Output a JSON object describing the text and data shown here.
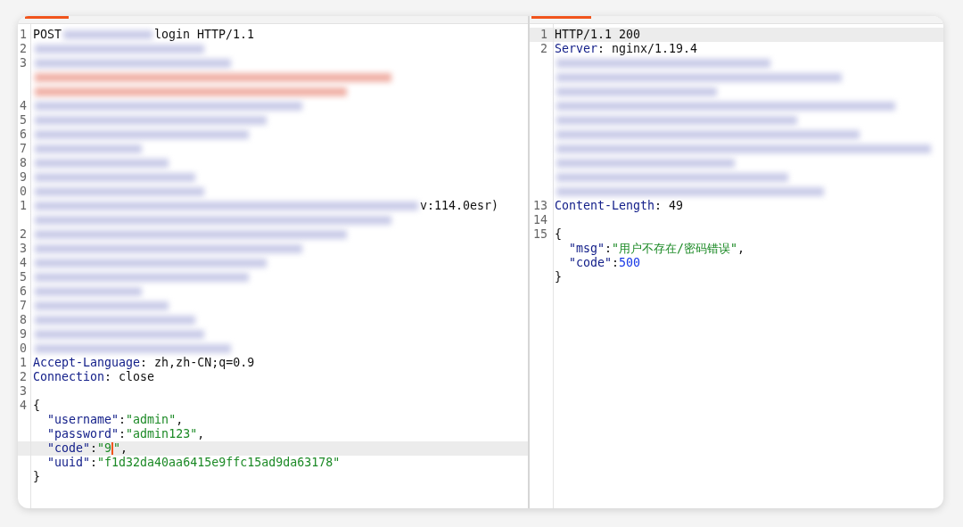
{
  "request": {
    "rows": [
      {
        "number": "1",
        "current": false,
        "segments": [
          {
            "kind": "plain",
            "text": "POST"
          },
          {
            "kind": "redacted"
          },
          {
            "kind": "plain",
            "text": "login HTTP/1.1"
          }
        ]
      },
      {
        "number": "2",
        "current": false,
        "segments": [
          {
            "kind": "redacted"
          }
        ]
      },
      {
        "number": "3",
        "current": false,
        "segments": [
          {
            "kind": "redacted"
          }
        ]
      },
      {
        "current": false,
        "segments": [
          {
            "kind": "redacted-alert"
          }
        ]
      },
      {
        "current": false,
        "segments": [
          {
            "kind": "redacted-alert"
          }
        ]
      },
      {
        "number": "4",
        "current": false,
        "segments": [
          {
            "kind": "redacted"
          }
        ]
      },
      {
        "number": "5",
        "current": false,
        "segments": [
          {
            "kind": "redacted"
          }
        ]
      },
      {
        "number": "6",
        "current": false,
        "segments": [
          {
            "kind": "redacted"
          }
        ]
      },
      {
        "number": "7",
        "current": false,
        "segments": [
          {
            "kind": "redacted"
          }
        ]
      },
      {
        "number": "8",
        "current": false,
        "segments": [
          {
            "kind": "redacted"
          }
        ]
      },
      {
        "number": "9",
        "current": false,
        "segments": [
          {
            "kind": "redacted"
          }
        ]
      },
      {
        "number": "0",
        "current": false,
        "segments": [
          {
            "kind": "redacted"
          }
        ]
      },
      {
        "number": "1",
        "current": false,
        "segments": [
          {
            "kind": "redacted"
          },
          {
            "kind": "plain",
            "text": "v:114.0esr)"
          }
        ]
      },
      {
        "current": false,
        "segments": [
          {
            "kind": "redacted"
          }
        ]
      },
      {
        "number": "2",
        "current": false,
        "segments": [
          {
            "kind": "redacted"
          }
        ]
      },
      {
        "number": "3",
        "current": false,
        "segments": [
          {
            "kind": "redacted"
          }
        ]
      },
      {
        "number": "4",
        "current": false,
        "segments": [
          {
            "kind": "redacted"
          }
        ]
      },
      {
        "number": "5",
        "current": false,
        "segments": [
          {
            "kind": "redacted"
          }
        ]
      },
      {
        "number": "6",
        "current": false,
        "segments": [
          {
            "kind": "redacted"
          }
        ]
      },
      {
        "number": "7",
        "current": false,
        "segments": [
          {
            "kind": "redacted"
          }
        ]
      },
      {
        "number": "8",
        "current": false,
        "segments": [
          {
            "kind": "redacted"
          }
        ]
      },
      {
        "number": "9",
        "current": false,
        "segments": [
          {
            "kind": "redacted"
          }
        ]
      },
      {
        "number": "0",
        "current": false,
        "segments": [
          {
            "kind": "redacted"
          }
        ]
      },
      {
        "number": "1",
        "current": false,
        "segments": [
          {
            "kind": "name",
            "text": "Accept-Language"
          },
          {
            "kind": "plain",
            "text": ": zh,zh-CN;q=0.9"
          }
        ]
      },
      {
        "number": "2",
        "current": false,
        "segments": [
          {
            "kind": "name",
            "text": "Connection"
          },
          {
            "kind": "plain",
            "text": ": close"
          }
        ]
      },
      {
        "number": "3",
        "current": false,
        "segments": []
      },
      {
        "number": "4",
        "current": false,
        "segments": [
          {
            "kind": "plain",
            "text": "{"
          }
        ]
      },
      {
        "current": false,
        "segments": [
          {
            "kind": "name",
            "text": "  \"username\""
          },
          {
            "kind": "plain",
            "text": ":"
          },
          {
            "kind": "string",
            "text": "\"admin\""
          },
          {
            "kind": "plain",
            "text": ","
          }
        ]
      },
      {
        "current": false,
        "segments": [
          {
            "kind": "name",
            "text": "  \"password\""
          },
          {
            "kind": "plain",
            "text": ":"
          },
          {
            "kind": "string",
            "text": "\"admin123\""
          },
          {
            "kind": "plain",
            "text": ","
          }
        ]
      },
      {
        "current": true,
        "segments": [
          {
            "kind": "name",
            "text": "  \"code\""
          },
          {
            "kind": "plain",
            "text": ":"
          },
          {
            "kind": "string",
            "text": "\"9"
          },
          {
            "kind": "caret"
          },
          {
            "kind": "string",
            "text": "\""
          },
          {
            "kind": "plain",
            "text": ","
          }
        ]
      },
      {
        "current": false,
        "segments": [
          {
            "kind": "name",
            "text": "  \"uuid\""
          },
          {
            "kind": "plain",
            "text": ":"
          },
          {
            "kind": "string",
            "text": "\"f1d32da40aa6415e9ffc15ad9da63178\""
          }
        ]
      },
      {
        "current": false,
        "segments": [
          {
            "kind": "plain",
            "text": "}"
          }
        ]
      }
    ]
  },
  "response": {
    "rows": [
      {
        "number": "1",
        "current": true,
        "segments": [
          {
            "kind": "plain",
            "text": "HTTP/1.1 200"
          }
        ]
      },
      {
        "number": "2",
        "current": false,
        "segments": [
          {
            "kind": "name",
            "text": "Server"
          },
          {
            "kind": "plain",
            "text": ": nginx/1.19.4"
          }
        ]
      },
      {
        "current": false,
        "segments": [
          {
            "kind": "redacted"
          }
        ]
      },
      {
        "current": false,
        "segments": [
          {
            "kind": "redacted"
          }
        ]
      },
      {
        "current": false,
        "segments": [
          {
            "kind": "redacted"
          }
        ]
      },
      {
        "current": false,
        "segments": [
          {
            "kind": "redacted"
          }
        ]
      },
      {
        "current": false,
        "segments": [
          {
            "kind": "redacted"
          }
        ]
      },
      {
        "current": false,
        "segments": [
          {
            "kind": "redacted"
          }
        ]
      },
      {
        "current": false,
        "segments": [
          {
            "kind": "redacted"
          }
        ]
      },
      {
        "current": false,
        "segments": [
          {
            "kind": "redacted"
          }
        ]
      },
      {
        "current": false,
        "segments": [
          {
            "kind": "redacted"
          }
        ]
      },
      {
        "current": false,
        "segments": [
          {
            "kind": "redacted"
          }
        ]
      },
      {
        "number": "13",
        "current": false,
        "segments": [
          {
            "kind": "name",
            "text": "Content-Length"
          },
          {
            "kind": "plain",
            "text": ": 49"
          }
        ]
      },
      {
        "number": "14",
        "current": false,
        "segments": []
      },
      {
        "number": "15",
        "current": false,
        "segments": [
          {
            "kind": "plain",
            "text": "{"
          }
        ]
      },
      {
        "current": false,
        "segments": [
          {
            "kind": "name",
            "text": "  \"msg\""
          },
          {
            "kind": "plain",
            "text": ":"
          },
          {
            "kind": "string",
            "text": "\"用户不存在/密码错误\""
          },
          {
            "kind": "plain",
            "text": ","
          }
        ]
      },
      {
        "current": false,
        "segments": [
          {
            "kind": "name",
            "text": "  \"code\""
          },
          {
            "kind": "plain",
            "text": ":"
          },
          {
            "kind": "number",
            "text": "500"
          }
        ]
      },
      {
        "current": false,
        "segments": [
          {
            "kind": "plain",
            "text": "}"
          }
        ]
      }
    ]
  }
}
